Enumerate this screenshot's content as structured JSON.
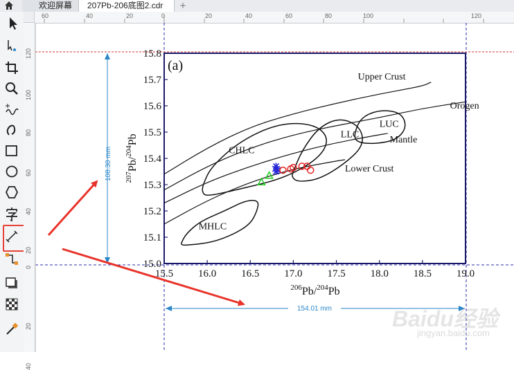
{
  "tabs": {
    "welcome_label": "欢迎屏幕",
    "file_label": "207Pb-206底图2.cdr",
    "add_label": "+"
  },
  "ruler": {
    "h_labels": [
      "60",
      "40",
      "20",
      "0",
      "20",
      "40",
      "60",
      "80",
      "100",
      "120"
    ],
    "v_labels": [
      "120",
      "100",
      "80",
      "60",
      "40",
      "20",
      "0",
      "20",
      "40"
    ]
  },
  "dimensions": {
    "height_label": "108.30 mm",
    "width_label": "154.01 mm"
  },
  "chart_data": {
    "type": "scatter",
    "panel_label": "(a)",
    "xlim": [
      15.5,
      19.0
    ],
    "ylim": [
      15.0,
      15.8
    ],
    "x_ticks": [
      "15.5",
      "16.0",
      "16.5",
      "17.0",
      "17.5",
      "18.0",
      "18.5",
      "19.0"
    ],
    "y_ticks": [
      "15.0",
      "15.1",
      "15.2",
      "15.3",
      "15.4",
      "15.5",
      "15.6",
      "15.7",
      "15.8"
    ],
    "xlabel_parts": [
      "206",
      "Pb/",
      "204",
      "Pb"
    ],
    "ylabel_parts": [
      "207",
      "Pb/",
      "204",
      "Pb"
    ],
    "curves": [
      {
        "name": "Upper Crust",
        "x": [
          15.5,
          16.0,
          16.5,
          17.0,
          17.5,
          18.0,
          18.5,
          18.6
        ],
        "y": [
          15.34,
          15.44,
          15.52,
          15.57,
          15.61,
          15.645,
          15.675,
          15.69
        ]
      },
      {
        "name": "Orogen",
        "x": [
          15.5,
          16.0,
          16.5,
          17.0,
          17.5,
          18.0,
          18.5,
          19.0
        ],
        "y": [
          15.28,
          15.37,
          15.44,
          15.49,
          15.525,
          15.555,
          15.59,
          15.615
        ]
      },
      {
        "name": "Mantle",
        "x": [
          15.5,
          16.0,
          16.5,
          17.0,
          17.5,
          18.0,
          18.1
        ],
        "y": [
          15.23,
          15.31,
          15.37,
          15.42,
          15.46,
          15.49,
          15.495
        ]
      },
      {
        "name": "Lower Crust",
        "x": [
          15.5,
          16.0,
          16.5,
          17.0,
          17.5,
          17.6
        ],
        "y": [
          15.15,
          15.24,
          15.31,
          15.36,
          15.39,
          15.395
        ]
      }
    ],
    "curve_labels": [
      {
        "text": "Upper Crust",
        "x": 17.75,
        "y": 15.7
      },
      {
        "text": "Orogen",
        "x": 18.82,
        "y": 15.59
      },
      {
        "text": "Mantle",
        "x": 18.12,
        "y": 15.46
      },
      {
        "text": "Lower Crust",
        "x": 17.6,
        "y": 15.35
      }
    ],
    "fields": [
      {
        "name": "CHLC",
        "label_x": 16.25,
        "label_y": 15.42,
        "outline": [
          [
            15.95,
            15.3
          ],
          [
            16.05,
            15.37
          ],
          [
            16.4,
            15.47
          ],
          [
            16.85,
            15.535
          ],
          [
            17.25,
            15.53
          ],
          [
            17.42,
            15.475
          ],
          [
            17.3,
            15.4
          ],
          [
            16.9,
            15.325
          ],
          [
            16.4,
            15.285
          ],
          [
            16.0,
            15.255
          ],
          [
            15.94,
            15.27
          ]
        ]
      },
      {
        "name": "LLC",
        "label_x": 17.55,
        "label_y": 15.48,
        "outline": [
          [
            17.0,
            15.35
          ],
          [
            17.1,
            15.43
          ],
          [
            17.3,
            15.52
          ],
          [
            17.55,
            15.555
          ],
          [
            17.78,
            15.52
          ],
          [
            17.82,
            15.45
          ],
          [
            17.6,
            15.38
          ],
          [
            17.3,
            15.32
          ],
          [
            17.05,
            15.31
          ],
          [
            16.98,
            15.33
          ]
        ]
      },
      {
        "name": "LUC",
        "label_x": 18.0,
        "label_y": 15.52,
        "outline": [
          [
            17.7,
            15.485
          ],
          [
            17.78,
            15.555
          ],
          [
            18.0,
            15.585
          ],
          [
            18.25,
            15.575
          ],
          [
            18.32,
            15.52
          ],
          [
            18.2,
            15.47
          ],
          [
            17.95,
            15.455
          ],
          [
            17.75,
            15.46
          ]
        ]
      },
      {
        "name": "MHLC",
        "label_x": 15.9,
        "label_y": 15.13,
        "outline": [
          [
            15.7,
            15.08
          ],
          [
            15.76,
            15.115
          ],
          [
            15.92,
            15.16
          ],
          [
            16.2,
            15.2
          ],
          [
            16.45,
            15.24
          ],
          [
            16.6,
            15.24
          ],
          [
            16.58,
            15.2
          ],
          [
            16.5,
            15.15
          ],
          [
            16.3,
            15.11
          ],
          [
            16.05,
            15.08
          ],
          [
            15.78,
            15.07
          ],
          [
            15.7,
            15.07
          ]
        ]
      }
    ],
    "markers": [
      {
        "shape": "triangle",
        "color": "#22cc22",
        "points": [
          [
            16.63,
            15.31
          ],
          [
            16.72,
            15.335
          ]
        ]
      },
      {
        "shape": "star",
        "color": "#2a2ad8",
        "points": [
          [
            16.79,
            15.36
          ],
          [
            16.8,
            15.35
          ],
          [
            16.81,
            15.36
          ],
          [
            16.8,
            15.37
          ],
          [
            16.82,
            15.355
          ]
        ]
      },
      {
        "shape": "circle",
        "color": "#e02020",
        "points": [
          [
            16.88,
            15.355
          ],
          [
            16.97,
            15.36
          ],
          [
            17.0,
            15.365
          ],
          [
            17.1,
            15.37
          ],
          [
            17.16,
            15.37
          ],
          [
            17.2,
            15.355
          ]
        ]
      }
    ]
  },
  "watermark": {
    "logo": "Baidu经验",
    "url": "jingyan.baidu.com"
  },
  "colors": {
    "guide": "#2a2aa8",
    "margin_guide": "#d03030",
    "dimension": "#2a86c8",
    "arrow": "#e8332a",
    "plot_frame": "#1a1a6a"
  }
}
